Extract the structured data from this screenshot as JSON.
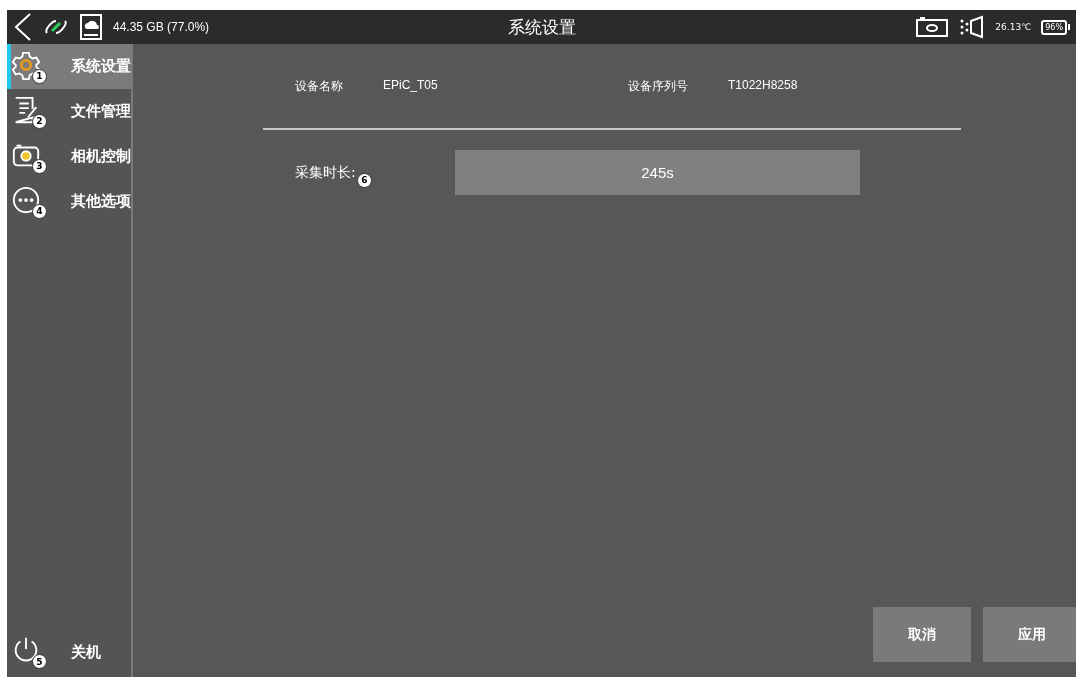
{
  "status_bar": {
    "storage": "44.35 GB (77.0%)",
    "title": "系统设置",
    "temperature": "26.13℃",
    "battery": "96%"
  },
  "sidebar": {
    "items": [
      {
        "label": "系统设置",
        "badge": "1",
        "kind": "gear",
        "selected": true
      },
      {
        "label": "文件管理",
        "badge": "2",
        "kind": "document",
        "selected": false
      },
      {
        "label": "相机控制",
        "badge": "3",
        "kind": "camera",
        "selected": false
      },
      {
        "label": "其他选项",
        "badge": "4",
        "kind": "more",
        "selected": false
      }
    ],
    "power": {
      "label": "关机",
      "badge": "5"
    }
  },
  "device_info": [
    {
      "label": "设备名称",
      "value": "EPiC_T05"
    },
    {
      "label": "设备序列号",
      "value": "T1022H8258"
    }
  ],
  "setting": {
    "label": "采集时长:",
    "badge": "6",
    "value": "245s"
  },
  "buttons": [
    "取消",
    "应用"
  ]
}
